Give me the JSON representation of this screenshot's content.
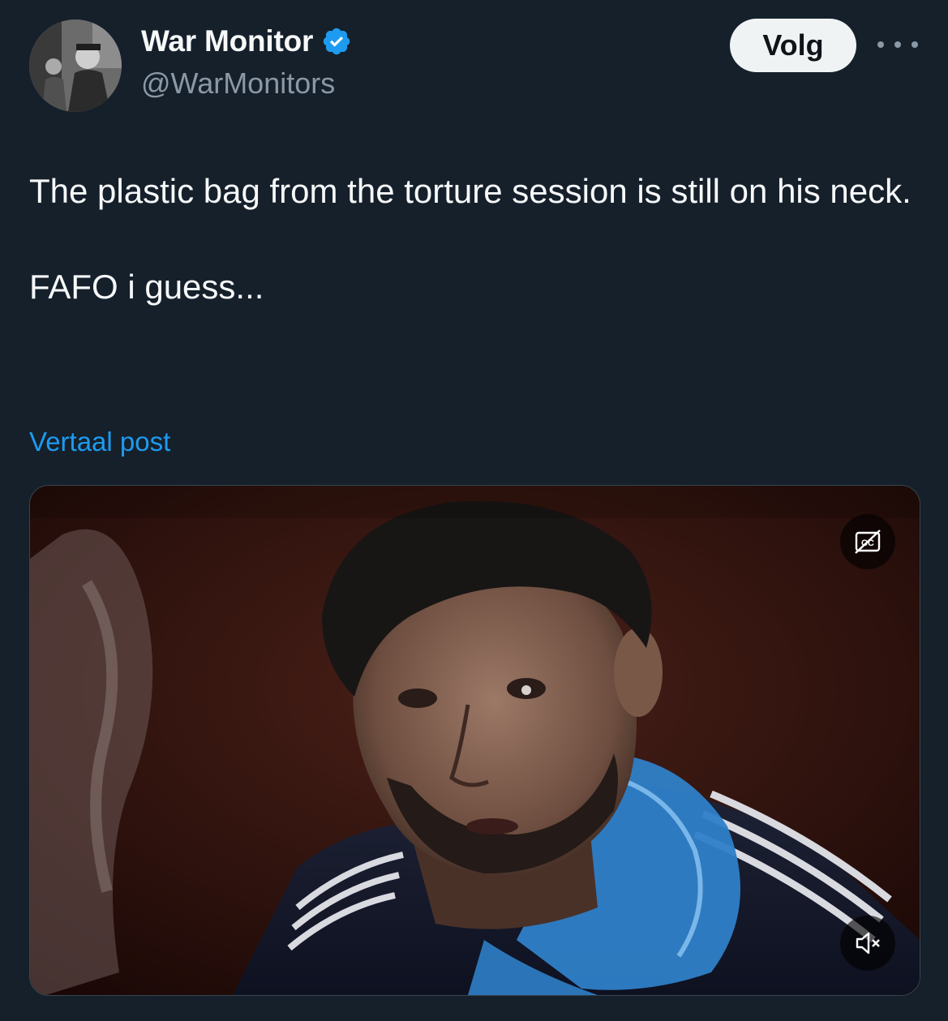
{
  "author": {
    "display_name": "War Monitor",
    "handle": "@WarMonitors",
    "verified": true
  },
  "actions": {
    "follow_label": "Volg",
    "more_icon": "more-dots-icon"
  },
  "post": {
    "paragraphs": [
      "The plastic bag from the torture session is still on his neck.",
      "FAFO i guess..."
    ],
    "translate_label": "Vertaal post"
  },
  "media": {
    "type": "video",
    "captions_icon": "closed-captions-off-icon",
    "mute_icon": "volume-muted-icon"
  },
  "colors": {
    "background": "#15202b",
    "text": "#f7f9f9",
    "secondary_text": "#8b98a5",
    "link": "#1d9bf0",
    "verified_badge": "#1d9bf0",
    "follow_button_bg": "#eff3f4"
  }
}
